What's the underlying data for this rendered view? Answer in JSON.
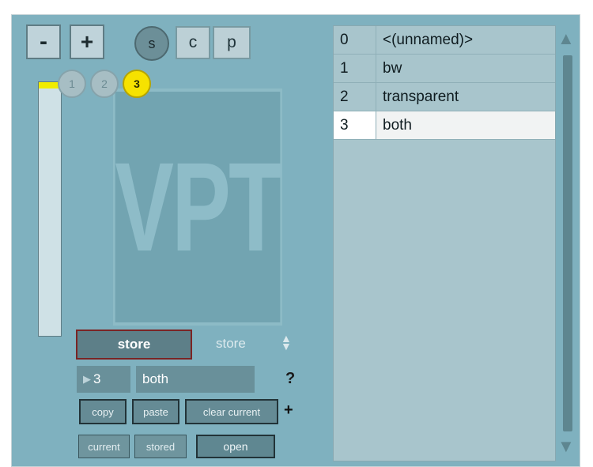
{
  "buttons": {
    "minus": "-",
    "plus": "+",
    "s": "s",
    "c": "c",
    "p": "p"
  },
  "presets": {
    "p1": "1",
    "p2": "2",
    "p3": "3",
    "active": "3"
  },
  "watermark": "VPT",
  "store": {
    "button_label": "store",
    "mode_label": "store",
    "number": "3",
    "name": "both",
    "help": "?"
  },
  "actions": {
    "copy": "copy",
    "paste": "paste",
    "clear_current": "clear current",
    "add": "+"
  },
  "tabs": {
    "current": "current",
    "stored": "stored",
    "open": "open"
  },
  "list": {
    "rows": [
      {
        "index": "0",
        "name": "<(unnamed)>"
      },
      {
        "index": "1",
        "name": "bw"
      },
      {
        "index": "2",
        "name": "transparent"
      },
      {
        "index": "3",
        "name": "both"
      }
    ],
    "selected_index": "3"
  },
  "colors": {
    "background": "#7fb1bf",
    "active_preset": "#f6e200",
    "store_border": "#7a2424"
  }
}
